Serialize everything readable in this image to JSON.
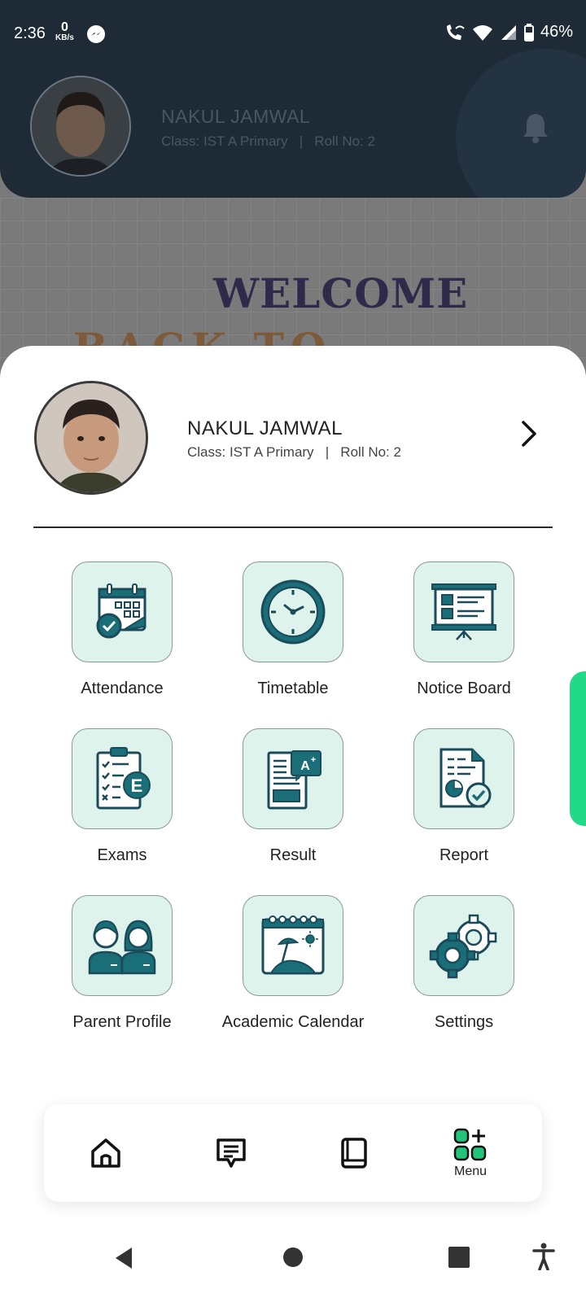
{
  "status_bar": {
    "time": "2:36",
    "speed_value": "0",
    "speed_unit": "KB/s",
    "battery": "46%"
  },
  "header": {
    "name": "NAKUL JAMWAL",
    "class_info": "Class: IST A Primary   |   Roll No: 2"
  },
  "banner": {
    "title": "WELCOME",
    "subtitle": "BACK TO SCHOOL"
  },
  "profile": {
    "name": "NAKUL JAMWAL",
    "class_info": "Class: IST A Primary   |   Roll No: 2"
  },
  "menu": {
    "items": [
      {
        "label": "Attendance",
        "icon": "attendance-calendar-icon"
      },
      {
        "label": "Timetable",
        "icon": "clock-icon"
      },
      {
        "label": "Notice Board",
        "icon": "notice-board-icon"
      },
      {
        "label": "Exams",
        "icon": "exam-checklist-icon"
      },
      {
        "label": "Result",
        "icon": "result-document-icon"
      },
      {
        "label": "Report",
        "icon": "report-icon"
      },
      {
        "label": "Parent Profile",
        "icon": "parents-icon"
      },
      {
        "label": "Academic Calendar",
        "icon": "academic-calendar-icon"
      },
      {
        "label": "Settings",
        "icon": "gears-icon"
      }
    ]
  },
  "bottom_nav": {
    "menu_label": "Menu",
    "active": "Menu"
  },
  "colors": {
    "accent_teal": "#1a6e78",
    "tile_bg": "#dff3ed",
    "menu_green": "#22c47a",
    "header_bg": "#1e2a36"
  }
}
